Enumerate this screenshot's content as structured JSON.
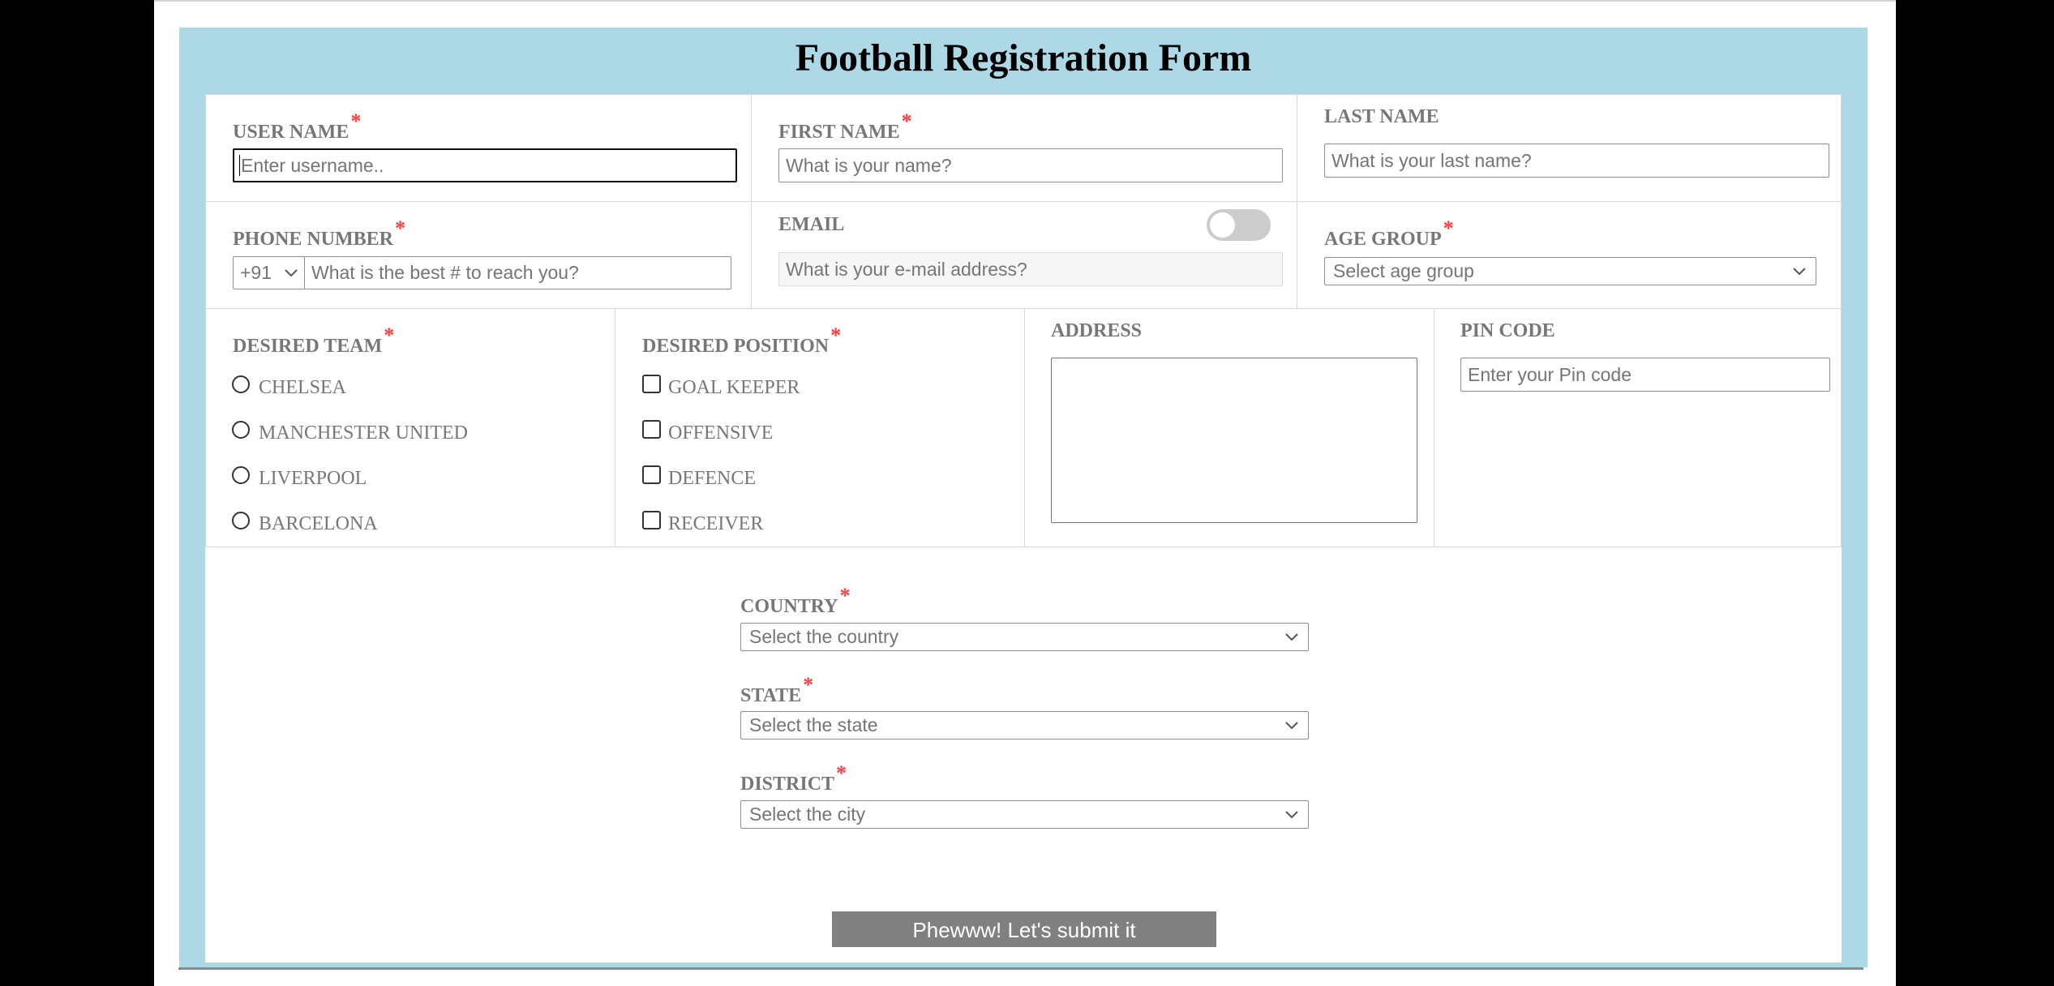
{
  "title": "Football Registration Form",
  "required_mark": "*",
  "username": {
    "label": "USER NAME",
    "placeholder": "Enter username.."
  },
  "firstname": {
    "label": "FIRST NAME",
    "placeholder": "What is your name?"
  },
  "lastname": {
    "label": "LAST NAME",
    "placeholder": "What is your last name?"
  },
  "phone": {
    "label": "PHONE NUMBER",
    "code": "+91",
    "placeholder": "What is the best # to reach you?"
  },
  "email": {
    "label": "EMAIL",
    "placeholder": "What is your e-mail address?",
    "toggle_on": false
  },
  "agegroup": {
    "label": "AGE GROUP",
    "selected": "Select age group"
  },
  "team": {
    "label": "DESIRED TEAM",
    "options": [
      "CHELSEA",
      "MANCHESTER UNITED",
      "LIVERPOOL",
      "BARCELONA"
    ]
  },
  "position": {
    "label": "DESIRED POSITION",
    "options": [
      "GOAL KEEPER",
      "OFFENSIVE",
      "DEFENCE",
      "RECEIVER"
    ]
  },
  "address": {
    "label": "ADDRESS"
  },
  "pincode": {
    "label": "PIN CODE",
    "placeholder": "Enter your Pin code"
  },
  "country": {
    "label": "COUNTRY",
    "selected": "Select the country"
  },
  "state": {
    "label": "STATE",
    "selected": "Select the state"
  },
  "district": {
    "label": "DISTRICT",
    "selected": "Select the city"
  },
  "submit": {
    "label": "Phewww! Let's submit it"
  },
  "colors": {
    "frame": "#add8e6",
    "required": "#ff3b3b",
    "label": "#777777",
    "submit": "#808080"
  }
}
